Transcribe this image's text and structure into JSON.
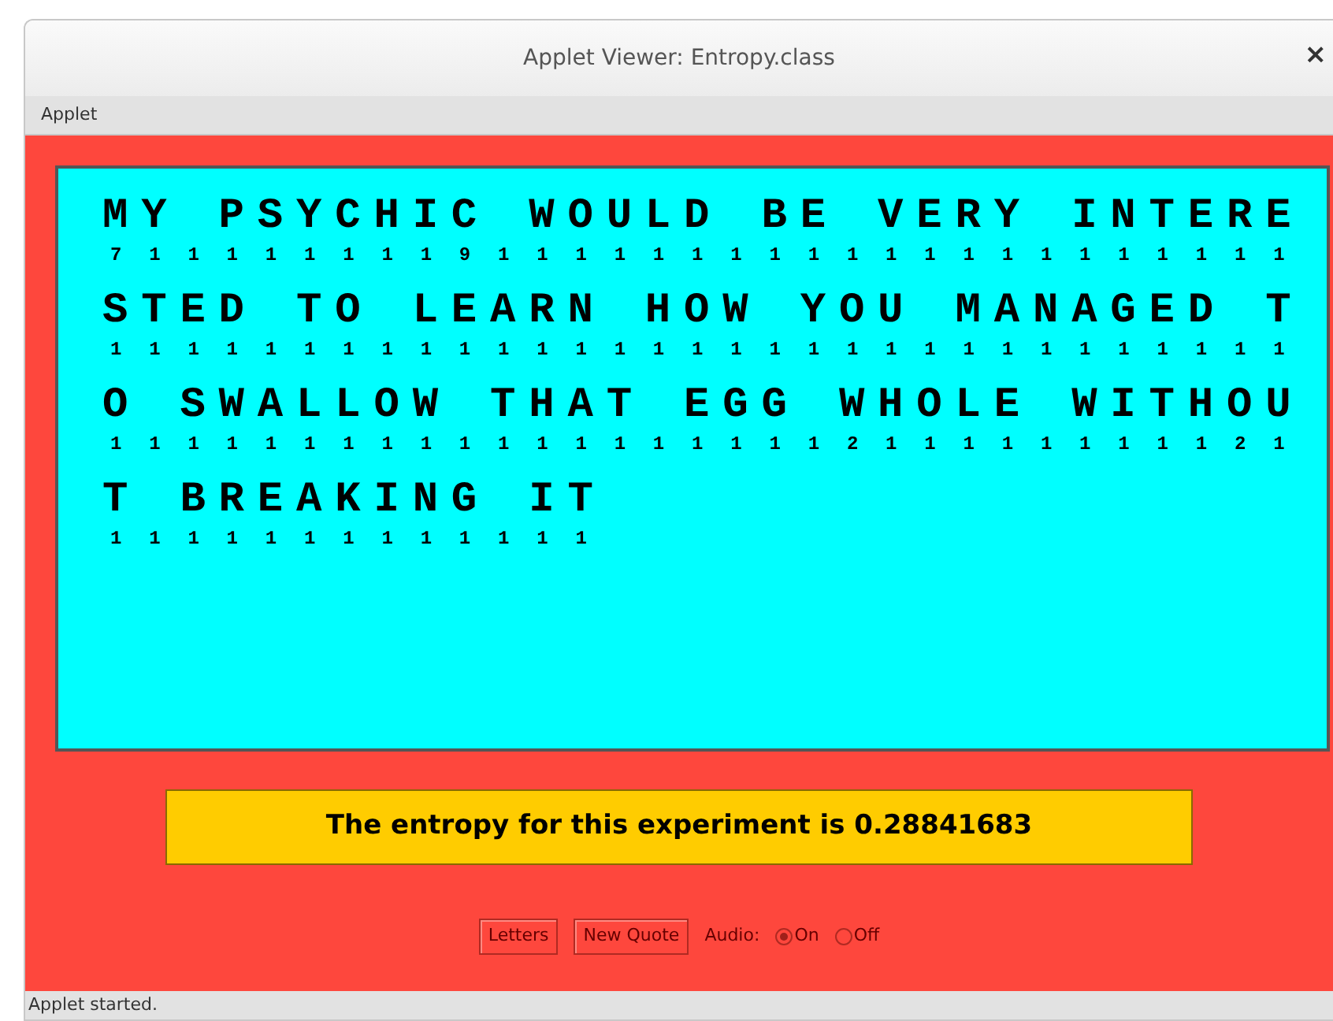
{
  "window": {
    "title": "Applet Viewer: Entropy.class",
    "close": "×"
  },
  "menu": [
    "Applet"
  ],
  "quote_lines": [
    {
      "text": "MY PSYCHIC WOULD BE VERY INTERE",
      "guesses": [
        "7",
        "1",
        "1",
        "1",
        "1",
        "1",
        "1",
        "1",
        "1",
        "9",
        "1",
        "1",
        "1",
        "1",
        "1",
        "1",
        "1",
        "1",
        "1",
        "1",
        "1",
        "1",
        "1",
        "1",
        "1",
        "1",
        "1",
        "1",
        "1",
        "1",
        "1"
      ]
    },
    {
      "text": "STED TO LEARN HOW YOU MANAGED T",
      "guesses": [
        "1",
        "1",
        "1",
        "1",
        "1",
        "1",
        "1",
        "1",
        "1",
        "1",
        "1",
        "1",
        "1",
        "1",
        "1",
        "1",
        "1",
        "1",
        "1",
        "1",
        "1",
        "1",
        "1",
        "1",
        "1",
        "1",
        "1",
        "1",
        "1",
        "1",
        "1"
      ]
    },
    {
      "text": "O SWALLOW THAT EGG WHOLE WITHOU",
      "guesses": [
        "1",
        "1",
        "1",
        "1",
        "1",
        "1",
        "1",
        "1",
        "1",
        "1",
        "1",
        "1",
        "1",
        "1",
        "1",
        "1",
        "1",
        "1",
        "1",
        "2",
        "1",
        "1",
        "1",
        "1",
        "1",
        "1",
        "1",
        "1",
        "1",
        "2",
        "1"
      ]
    },
    {
      "text": "T BREAKING IT",
      "guesses": [
        "1",
        "1",
        "1",
        "1",
        "1",
        "1",
        "1",
        "1",
        "1",
        "1",
        "1",
        "1",
        "1"
      ]
    }
  ],
  "result": "The entropy for this experiment is 0.28841683",
  "buttons": [
    "Letters",
    "New Quote"
  ],
  "audio": {
    "label": "Audio:",
    "options": [
      {
        "label": "On",
        "selected": true
      },
      {
        "label": "Off",
        "selected": false
      }
    ]
  },
  "status_bar": "Applet started."
}
